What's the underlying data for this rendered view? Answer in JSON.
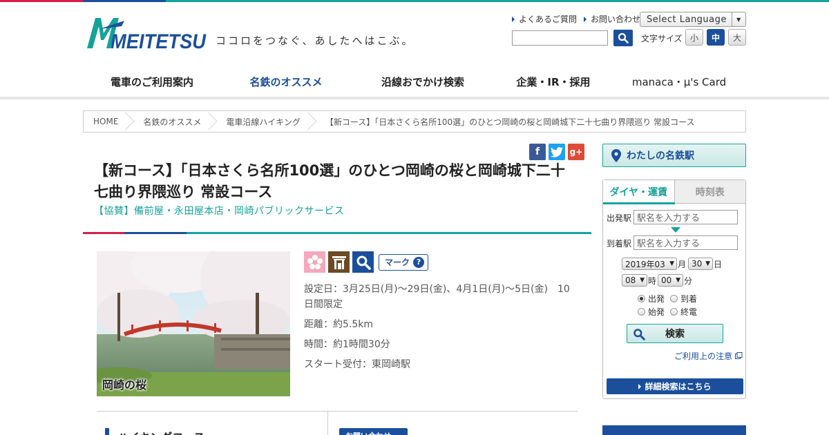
{
  "brand": {
    "logo_text": "MEITETSU",
    "tagline": "ココロをつなぐ、あしたへはこぶ。",
    "colors": {
      "blue": "#1b4f9c",
      "teal": "#14a39a",
      "red": "#d51f4b"
    }
  },
  "utility": {
    "faq": "よくあるご質問",
    "contact": "お問い合わせ",
    "language": "Select Language",
    "font_size_label": "文字サイズ",
    "font_sizes": [
      "小",
      "中",
      "大"
    ],
    "font_size_selected": "中"
  },
  "gnav": [
    {
      "label": "電車のご利用案内"
    },
    {
      "label": "名鉄のオススメ"
    },
    {
      "label": "沿線おでかけ検索"
    },
    {
      "label": "企業・IR・採用"
    },
    {
      "label": "manaca・μ's Card"
    }
  ],
  "gnav_active": "名鉄のオススメ",
  "breadcrumb": [
    "HOME",
    "名鉄のオススメ",
    "電車沿線ハイキング",
    "【新コース】「日本さくら名所100選」のひとつ岡崎の桜と岡崎城下二十七曲り界隈巡り 常設コース"
  ],
  "social": [
    "facebook-icon",
    "twitter-icon",
    "google-plus-icon"
  ],
  "social_labels": {
    "facebook": "f",
    "google": "g+"
  },
  "page": {
    "title": "【新コース】「日本さくら名所100選」のひとつ岡崎の桜と岡崎城下二十七曲り界隈巡り 常設コース",
    "sponsor": "【協賛】備前屋・永田屋本店・岡崎パブリックサービス"
  },
  "course": {
    "photo_caption": "岡崎の桜",
    "mark_button": "マーク",
    "info": [
      "設定日：3月25日(月)～29日(金)、4月1日(月)～5日(金)　10日間限定",
      "距離：約5.5km",
      "時間：約1時間30分",
      "スタート受付：東岡崎駅"
    ]
  },
  "lower": {
    "hiking_heading": "ハイキングコース",
    "contact_button": "お問い合わせ"
  },
  "sidebar": {
    "my_station": "わたしの名鉄駅",
    "tabs": [
      "ダイヤ・運賃",
      "時刻表"
    ],
    "active_tab": "ダイヤ・運賃",
    "from_label": "出発駅",
    "to_label": "到着駅",
    "station_placeholder": "駅名を入力する",
    "date": {
      "year_month": "2019年03",
      "month_unit": "月",
      "day": "30",
      "day_unit": "日",
      "hour": "08",
      "hour_unit": "時",
      "minute": "00",
      "minute_unit": "分"
    },
    "radio_options": [
      {
        "label": "出発",
        "checked": true
      },
      {
        "label": "到着",
        "checked": false
      },
      {
        "label": "始発",
        "checked": false
      },
      {
        "label": "終電",
        "checked": false
      }
    ],
    "search_button": "検索",
    "notice_link": "ご利用上の注意",
    "detail_button": "詳細検索はこちら"
  }
}
